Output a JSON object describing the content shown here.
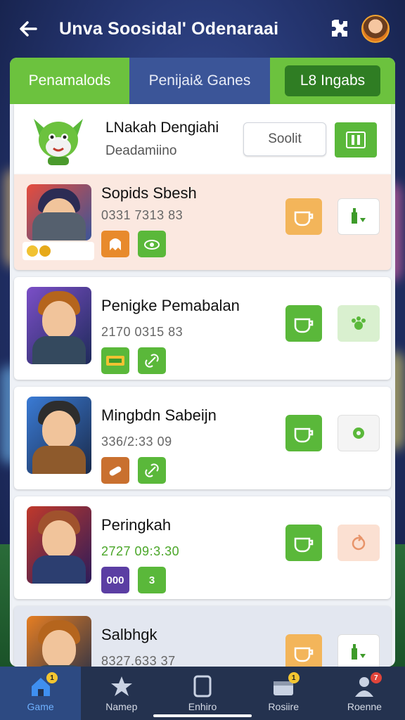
{
  "header": {
    "title": "Unva Soosidal' Odenaraai",
    "back_icon": "arrow-left-icon",
    "settings_icon": "puzzle-gear-icon",
    "avatar_icon": "user-avatar"
  },
  "tabs": [
    {
      "label": "Penamalods"
    },
    {
      "label": "Penijai& Ganes"
    },
    {
      "label": "L8 Ingabs"
    }
  ],
  "top_card": {
    "name": "LNakah Dengiahi",
    "subtitle": "Deadamiino",
    "search_label": "Soolit",
    "mascot_icon": "green-cat-mascot"
  },
  "rows": [
    {
      "name": "Sopids Sbesh",
      "code": "0331 7313 83",
      "code_color": "#666666",
      "bg": "#fbe8e0",
      "badges": [
        {
          "text": "",
          "color": "#e88a2c"
        },
        {
          "text": "",
          "color": "#5ab83a"
        }
      ],
      "btn_a": "orange",
      "btn_b": "white"
    },
    {
      "name": "Penigke Pemabalan",
      "code": "2170 0315 83",
      "code_color": "#666666",
      "bg": "#ffffff",
      "badges": [
        {
          "text": "",
          "color": "#5ab83a"
        },
        {
          "text": "",
          "color": "#5ab83a"
        }
      ],
      "btn_a": "green",
      "btn_b": "pale"
    },
    {
      "name": "Mingbdn Sabeijn",
      "code": "336/2:33 09",
      "code_color": "#666666",
      "bg": "#ffffff",
      "badges": [
        {
          "text": "",
          "color": "#c9702f"
        },
        {
          "text": "",
          "color": "#5ab83a"
        }
      ],
      "btn_a": "green",
      "btn_b": "grey"
    },
    {
      "name": "Peringkah",
      "code": "2727 09:3.30",
      "code_color": "#4aa628",
      "bg": "#ffffff",
      "badges": [
        {
          "text": "000",
          "color": "#5b3ea3"
        },
        {
          "text": "3",
          "color": "#5ab83a"
        }
      ],
      "btn_a": "green",
      "btn_b": "peach"
    },
    {
      "name": "Salbhgk",
      "code": "8327.633 37",
      "code_color": "#666666",
      "bg": "#e3e7f0",
      "badges": [],
      "btn_a": "orange",
      "btn_b": "white"
    }
  ],
  "navbar": [
    {
      "label": "Game",
      "icon": "home-icon",
      "badge": "1",
      "badge_color": "#f3c531"
    },
    {
      "label": "Namep",
      "icon": "star-icon",
      "badge": "",
      "badge_color": ""
    },
    {
      "label": "Enhiro",
      "icon": "card-icon",
      "badge": "",
      "badge_color": ""
    },
    {
      "label": "Rosiire",
      "icon": "chest-icon",
      "badge": "1",
      "badge_color": "#f3c531"
    },
    {
      "label": "Roenne",
      "icon": "profile-icon",
      "badge": "7",
      "badge_color": "#e0443a"
    }
  ]
}
